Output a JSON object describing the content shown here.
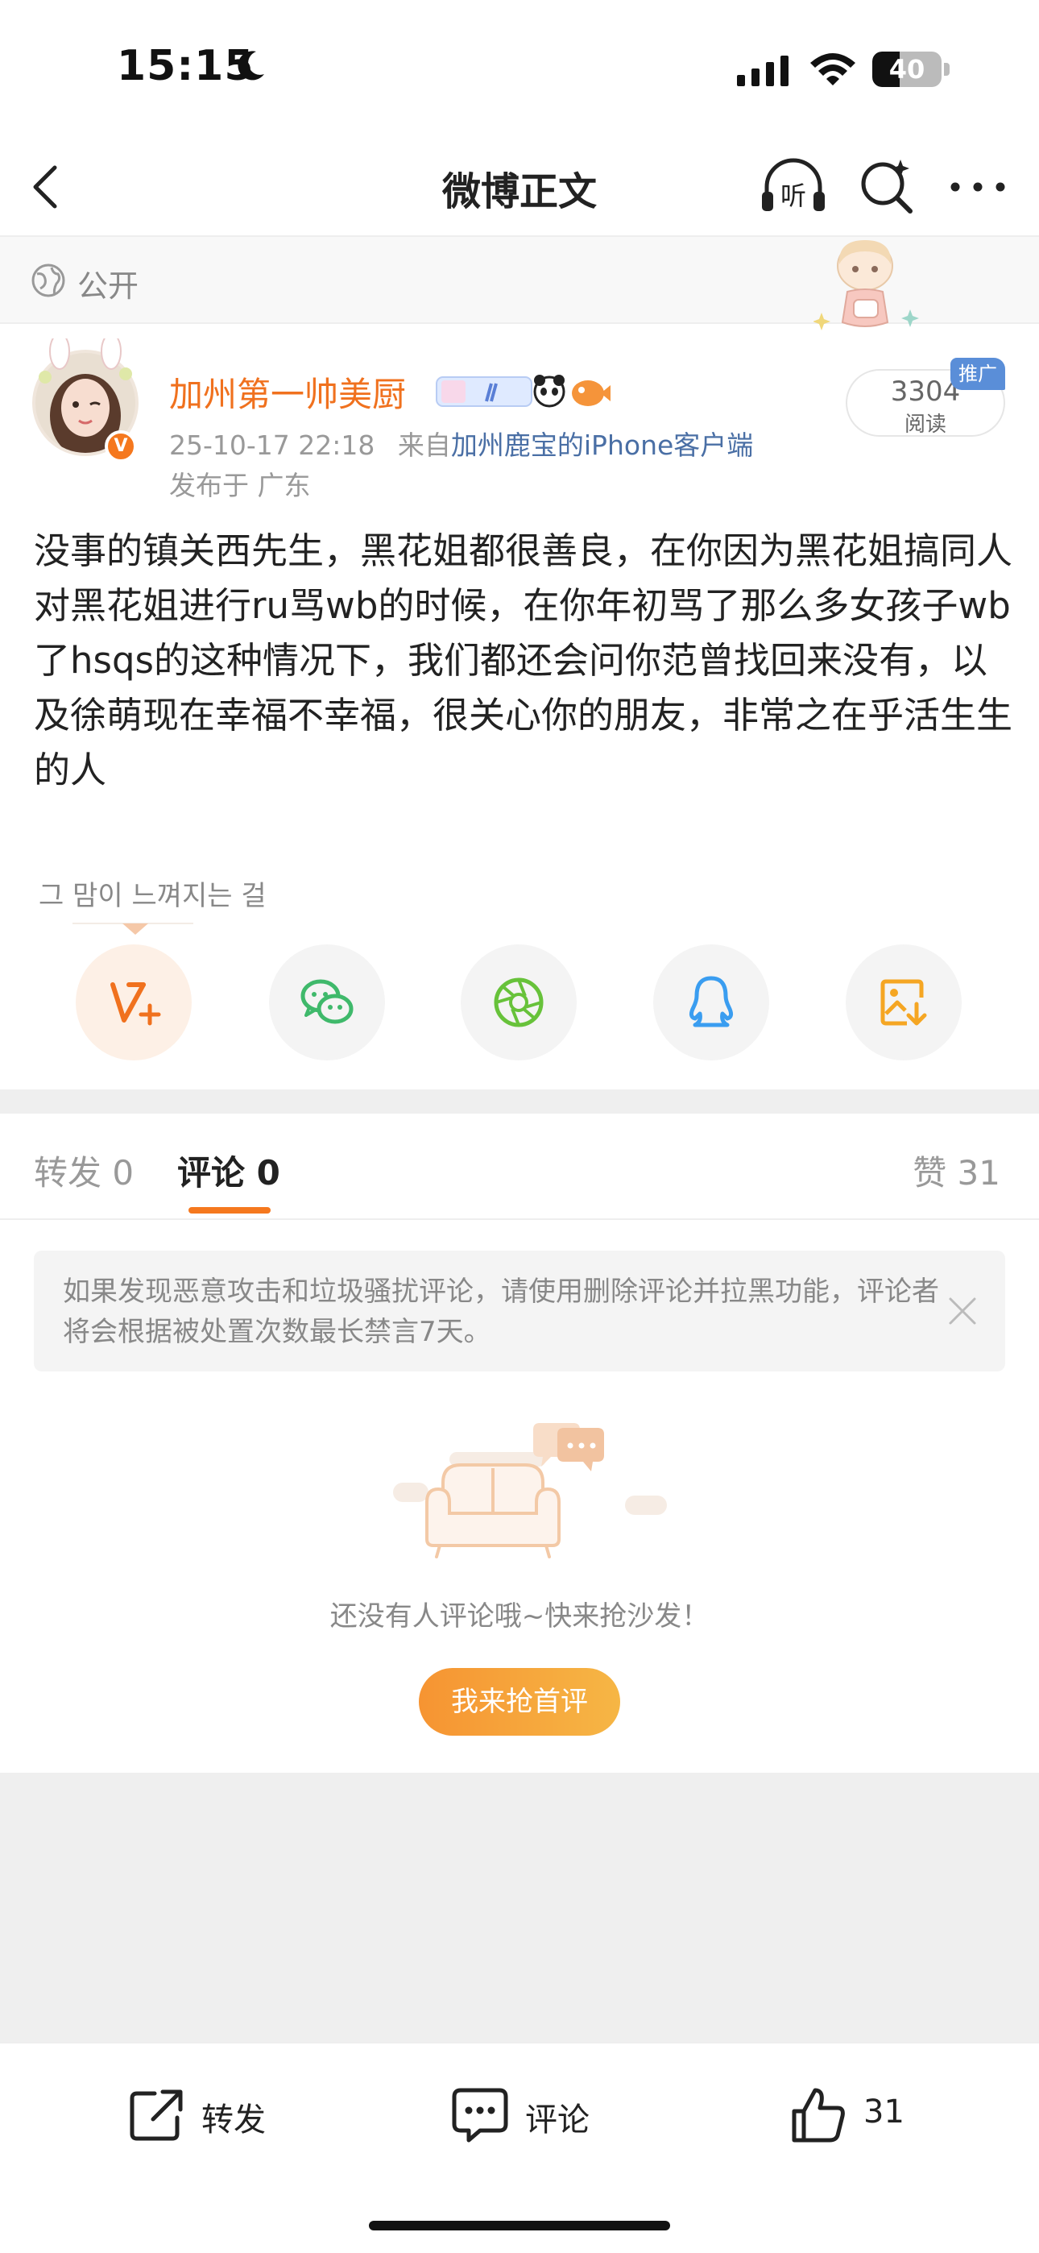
{
  "status_bar": {
    "time": "15:15",
    "battery": "40",
    "battery_level": 0.4
  },
  "nav": {
    "title": "微博正文",
    "listen_label": "听"
  },
  "visibility": {
    "label": "公开"
  },
  "post": {
    "username": "加州第一帅美厨",
    "verify_mark": "V",
    "timestamp": "25-10-17 22:18",
    "source_prefix": "来自",
    "source": "加州鹿宝的iPhone客户端",
    "location": "发布于 广东",
    "read_count": "3304",
    "read_label": "阅读",
    "promo_tag": "推广",
    "text": "没事的镇关西先生，黑花姐都很善良，在你因为黑花姐搞同人对黑花姐进行ru骂wb的时候，在你年初骂了那么多女孩子wb了hsqs的这种情况下，我们都还会问你范曾找回来没有，以及徐萌现在幸福不幸福，很关心你的朋友，非常之在乎活生生的人",
    "caption": "그 맘이 느껴지는 걸"
  },
  "share": [
    {
      "name": "weibo-repost",
      "icon": "weibo-v-plus-icon"
    },
    {
      "name": "wechat",
      "icon": "wechat-icon"
    },
    {
      "name": "moments",
      "icon": "moments-icon"
    },
    {
      "name": "qq",
      "icon": "qq-icon"
    },
    {
      "name": "save-image",
      "icon": "save-image-icon"
    }
  ],
  "tabs": {
    "repost": "转发 0",
    "comments": "评论 0",
    "likes": "赞 31"
  },
  "notice": {
    "text": "如果发现恶意攻击和垃圾骚扰评论，请使用删除评论并拉黑功能，评论者将会根据被处置次数最长禁言7天。"
  },
  "empty_state": {
    "text": "还没有人评论哦~快来抢沙发！",
    "button": "我来抢首评"
  },
  "bottom_bar": {
    "repost": "转发",
    "comment": "评论",
    "like": "31"
  },
  "colors": {
    "accent": "#f5781e",
    "username": "#f0711e",
    "link": "#4a6fa5",
    "promo": "#5a8ed8"
  }
}
